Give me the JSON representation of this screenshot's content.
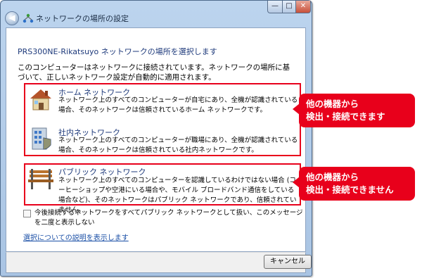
{
  "window": {
    "title": "ネットワークの場所の設定",
    "controls": {
      "minimize": "—",
      "maximize": "□",
      "close": "✕"
    }
  },
  "dialog": {
    "heading": "PRS300NE-Rikatsuyo ネットワークの場所を選択します",
    "intro": "このコンピューターはネットワークに接続されています。ネットワークの場所に基づいて、正しいネットワーク設定が自動的に適用されます。",
    "options": [
      {
        "title": "ホーム ネットワーク",
        "description": "ネットワーク上のすべてのコンピューターが自宅にあり、全機が認識されている場合、そのネットワークは信頼されているホーム ネットワークです。",
        "icon": "home-icon"
      },
      {
        "title": "社内ネットワーク",
        "description": "ネットワーク上のすべてのコンピューターが職場にあり、全機が認識されている場合、そのネットワークは信頼されている社内ネットワークです。",
        "icon": "office-building-icon"
      },
      {
        "title": "パブリック ネットワーク",
        "description": "ネットワーク上のすべてのコンピューターを認識しているわけではない場合 (コーヒーショップや空港にいる場合や、モバイル ブロードバンド通信をしている場合など)、そのネットワークはパブリック ネットワークであり、信頼されていません。",
        "icon": "park-bench-icon"
      }
    ],
    "checkbox_label": "今後接続するネットワークをすべてパブリック ネットワークとして扱い、このメッセージを二度と表示しない",
    "checkbox_checked": false,
    "help_link": "選択についての説明を表示します",
    "cancel_label": "キャンセル"
  },
  "callouts": [
    {
      "line1": "他の機器から",
      "line2": "検出・接続できます"
    },
    {
      "line1": "他の機器から",
      "line2": "検出・接続できません"
    }
  ],
  "colors": {
    "highlight": "#e8001b",
    "link": "#1a4fa6"
  }
}
